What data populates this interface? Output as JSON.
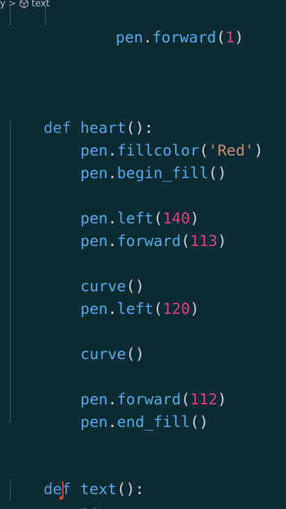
{
  "breadcrumb": {
    "leading": "y",
    "separator": ">",
    "item": "text"
  },
  "editor": {
    "top_line": {
      "obj": "pen",
      "dot": ".",
      "method": "forward",
      "open": "(",
      "arg": "1",
      "close": ")"
    },
    "heart_def": {
      "keyword": "def",
      "name": "heart",
      "sig": "():"
    },
    "heart_body": [
      {
        "obj": "pen",
        "dot": ".",
        "method": "fillcolor",
        "open": "(",
        "arg": "'Red'",
        "close": ")"
      },
      {
        "obj": "pen",
        "dot": ".",
        "method": "begin_fill",
        "open": "(",
        "arg": "",
        "close": ")"
      },
      {
        "obj": "pen",
        "dot": ".",
        "method": "left",
        "open": "(",
        "arg": "140",
        "close": ")"
      },
      {
        "obj": "pen",
        "dot": ".",
        "method": "forward",
        "open": "(",
        "arg": "113",
        "close": ")"
      },
      {
        "obj": "",
        "dot": "",
        "method": "curve",
        "open": "(",
        "arg": "",
        "close": ")"
      },
      {
        "obj": "pen",
        "dot": ".",
        "method": "left",
        "open": "(",
        "arg": "120",
        "close": ")"
      },
      {
        "obj": "",
        "dot": "",
        "method": "curve",
        "open": "(",
        "arg": "",
        "close": ")"
      },
      {
        "obj": "pen",
        "dot": ".",
        "method": "forward",
        "open": "(",
        "arg": "112",
        "close": ")"
      },
      {
        "obj": "pen",
        "dot": ".",
        "method": "end_fill",
        "open": "(",
        "arg": "",
        "close": ")"
      }
    ],
    "text_def": {
      "keyword": "def",
      "name": "text",
      "sig": "():"
    },
    "typing_line": "pe"
  },
  "colors": {
    "background": "#0c2b33",
    "keyword": "#569cd6",
    "identifier": "#5aa7e8",
    "number": "#e0407a",
    "string": "#ce9178",
    "cursor": "#e83838"
  },
  "icons": {
    "breadcrumb_symbol": "cube-outline-icon"
  }
}
